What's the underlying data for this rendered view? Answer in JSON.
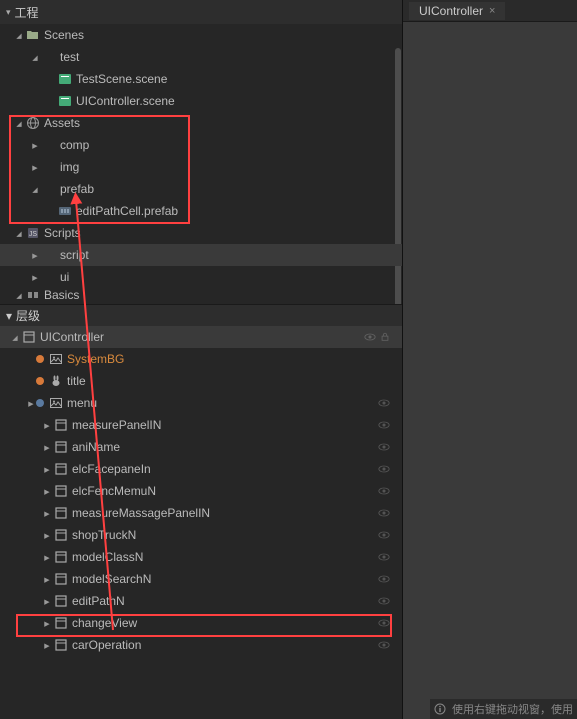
{
  "headers": {
    "project": "工程",
    "hierarchy": "层级"
  },
  "right_tab": {
    "label": "UIController"
  },
  "project_tree": [
    {
      "indent": 0,
      "arrow": "open",
      "icon": "folder",
      "label": "Scenes"
    },
    {
      "indent": 1,
      "arrow": "open",
      "icon": "none",
      "label": "test"
    },
    {
      "indent": 2,
      "arrow": "none",
      "icon": "scene",
      "label": "TestScene.scene"
    },
    {
      "indent": 2,
      "arrow": "none",
      "icon": "scene",
      "label": "UIController.scene"
    },
    {
      "indent": 0,
      "arrow": "open",
      "icon": "globe",
      "label": "Assets"
    },
    {
      "indent": 1,
      "arrow": "closed",
      "icon": "none",
      "label": "comp"
    },
    {
      "indent": 1,
      "arrow": "closed",
      "icon": "none",
      "label": "img"
    },
    {
      "indent": 1,
      "arrow": "open",
      "icon": "none",
      "label": "prefab"
    },
    {
      "indent": 2,
      "arrow": "none",
      "icon": "prefab",
      "label": "editPathCell.prefab"
    },
    {
      "indent": 0,
      "arrow": "open",
      "icon": "scripts",
      "label": "Scripts"
    },
    {
      "indent": 1,
      "arrow": "closed",
      "icon": "none",
      "label": "script",
      "selected": true
    },
    {
      "indent": 1,
      "arrow": "closed",
      "icon": "none",
      "label": "ui"
    },
    {
      "indent": 0,
      "arrow": "open",
      "icon": "basics",
      "label": "Basics",
      "clipped": true
    }
  ],
  "hierarchy_tree": [
    {
      "indent": 0,
      "arrow": "open",
      "icon": "node",
      "label": "UIController",
      "selected": true,
      "eye": true,
      "lock": true
    },
    {
      "indent": 1,
      "arrow": "none",
      "dot": "orange",
      "icon": "image",
      "label": "SystemBG",
      "highlight": true
    },
    {
      "indent": 1,
      "arrow": "none",
      "dot": "orange",
      "icon": "bunny",
      "label": "title"
    },
    {
      "indent": 1,
      "arrow": "closed",
      "dot": "blue",
      "icon": "image",
      "label": "menu",
      "eye": true
    },
    {
      "indent": 2,
      "arrow": "closed",
      "icon": "node",
      "label": "measurePanelIN",
      "eye": true
    },
    {
      "indent": 2,
      "arrow": "closed",
      "icon": "node",
      "label": "aniName",
      "eye": true
    },
    {
      "indent": 2,
      "arrow": "closed",
      "icon": "node",
      "label": "elcFacepaneIn",
      "eye": true
    },
    {
      "indent": 2,
      "arrow": "closed",
      "icon": "node",
      "label": "elcFencMemuN",
      "eye": true
    },
    {
      "indent": 2,
      "arrow": "closed",
      "icon": "node",
      "label": "measureMassagePanelIN",
      "eye": true
    },
    {
      "indent": 2,
      "arrow": "closed",
      "icon": "node",
      "label": "shopTruckN",
      "eye": true
    },
    {
      "indent": 2,
      "arrow": "closed",
      "icon": "node",
      "label": "modelClassN",
      "eye": true
    },
    {
      "indent": 2,
      "arrow": "closed",
      "icon": "node",
      "label": "modelSearchN",
      "eye": true
    },
    {
      "indent": 2,
      "arrow": "closed",
      "icon": "node",
      "label": "editPathN",
      "eye": true
    },
    {
      "indent": 2,
      "arrow": "closed",
      "icon": "node",
      "label": "changeView",
      "eye": true
    },
    {
      "indent": 2,
      "arrow": "closed",
      "icon": "node",
      "label": "carOperation",
      "eye": true
    }
  ],
  "status_bar": "使用右键拖动视窗，使用"
}
